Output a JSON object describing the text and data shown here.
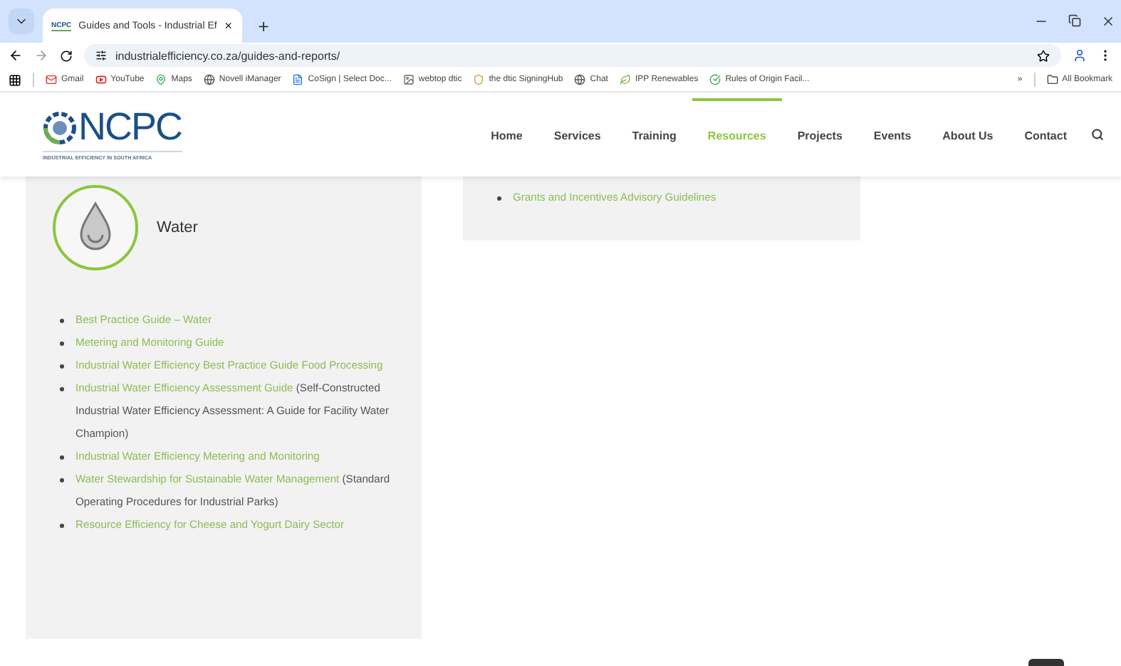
{
  "browser": {
    "tab_title": "Guides and Tools - Industrial Ef",
    "tab_favicon": "NCPC",
    "new_tab": "+",
    "url": "industrialefficiency.co.za/guides-and-reports/",
    "bookmarks": [
      {
        "label": "Gmail",
        "kind": "gmail"
      },
      {
        "label": "YouTube",
        "kind": "youtube"
      },
      {
        "label": "Maps",
        "kind": "maps"
      },
      {
        "label": "Novell iManager",
        "kind": "globe"
      },
      {
        "label": "CoSign | Select Doc...",
        "kind": "doc"
      },
      {
        "label": "webtop dtic",
        "kind": "image"
      },
      {
        "label": "the dtic SigningHub",
        "kind": "crest"
      },
      {
        "label": "Chat",
        "kind": "globe"
      },
      {
        "label": "IPP Renewables",
        "kind": "leaf"
      },
      {
        "label": "Rules of Origin Facil...",
        "kind": "check"
      }
    ],
    "more": "»",
    "all_bookmarks": "All Bookmark"
  },
  "site": {
    "logo_text": "NCPC",
    "tagline": "INDUSTRIAL EFFICIENCY IN SOUTH AFRICA",
    "nav": [
      {
        "label": "Home",
        "selected": false
      },
      {
        "label": "Services",
        "selected": false
      },
      {
        "label": "Training",
        "selected": false
      },
      {
        "label": "Resources",
        "selected": true
      },
      {
        "label": "Projects",
        "selected": false
      },
      {
        "label": "Events",
        "selected": false
      },
      {
        "label": "About Us",
        "selected": false
      },
      {
        "label": "Contact",
        "selected": false
      }
    ]
  },
  "water": {
    "title": "Water",
    "items": [
      {
        "link": "Best Practice Guide – Water"
      },
      {
        "link": "Metering and Monitoring Guide"
      },
      {
        "link": "Industrial Water Efficiency Best Practice Guide Food Processing"
      },
      {
        "link": "Industrial Water Efficiency Assessment Guide",
        "note": "(Self-Constructed Industrial Water Efficiency Assessment: A Guide for Facility Water Champion)"
      },
      {
        "link": "Industrial Water Efficiency Metering and Monitoring"
      },
      {
        "link": "Water Stewardship for Sustainable Water Management",
        "note": "(Standard Operating Procedures for Industrial Parks)"
      },
      {
        "link": "Resource Efficiency for Cheese and Yogurt Dairy Sector"
      }
    ]
  },
  "other": {
    "items": [
      {
        "link": "Grants and Incentives Advisory Guidelines"
      }
    ]
  }
}
